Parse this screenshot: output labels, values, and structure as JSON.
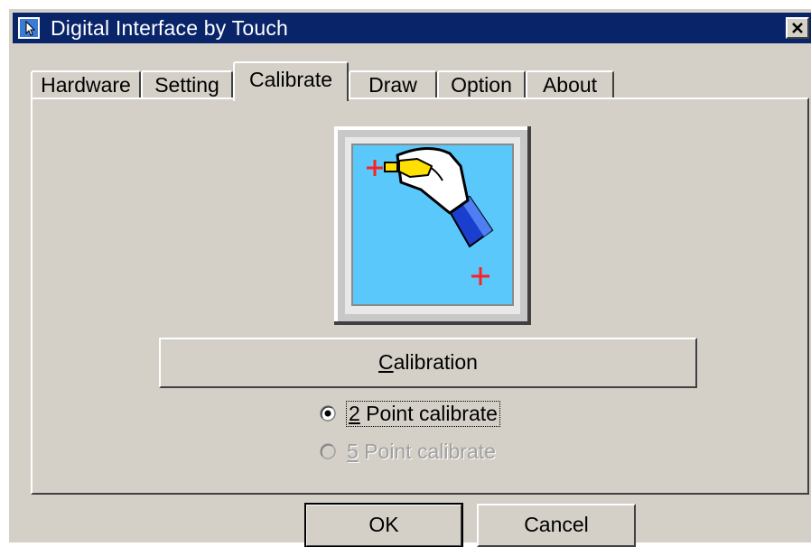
{
  "window": {
    "title": "Digital Interface by Touch",
    "close_glyph": "✕"
  },
  "tabs": [
    {
      "label": "Hardware",
      "active": false
    },
    {
      "label": "Setting",
      "active": false
    },
    {
      "label": "Calibrate",
      "active": true
    },
    {
      "label": "Draw",
      "active": false
    },
    {
      "label": "Option",
      "active": false
    },
    {
      "label": "About",
      "active": false
    }
  ],
  "calibrate": {
    "illustration_icon": "stylus-touch-calibration-icon",
    "button_accel": "C",
    "button_rest": "alibration",
    "options": [
      {
        "accel": "2",
        "rest": " Point calibrate",
        "selected": true,
        "enabled": true
      },
      {
        "accel": "5",
        "rest": " Point calibrate",
        "selected": false,
        "enabled": false
      }
    ]
  },
  "footer": {
    "ok_label": "OK",
    "cancel_label": "Cancel"
  },
  "colors": {
    "titlebar": "#0a246a",
    "face": "#d4d0c8",
    "screen_blue": "#5ac8fa",
    "crosshair_red": "#ff2020"
  }
}
